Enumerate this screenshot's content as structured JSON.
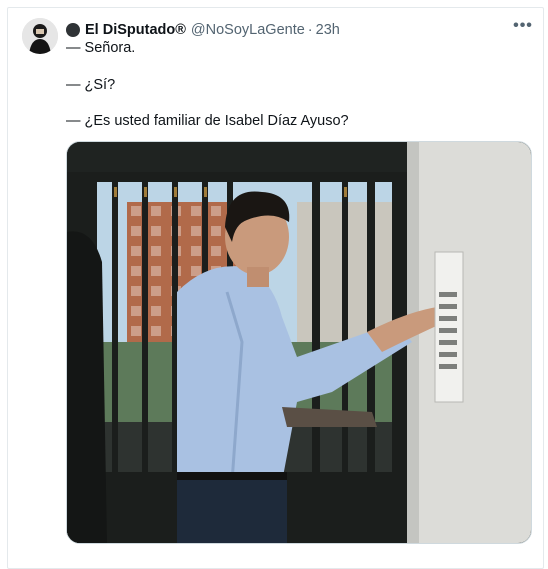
{
  "tweet": {
    "display_name": "El DiSputado",
    "registered_mark": "®",
    "handle": "@NoSoyLaGente",
    "separator": "·",
    "timestamp": "23h",
    "more_label": "•••",
    "lines": [
      "— Señora.",
      "— ¿Sí?",
      "— ¿Es usted familiar de Isabel Díaz Ayuso?"
    ]
  },
  "icons": {
    "avatar": "user-avatar",
    "bullet": "profile-bullet-icon",
    "more": "more-options-icon"
  }
}
